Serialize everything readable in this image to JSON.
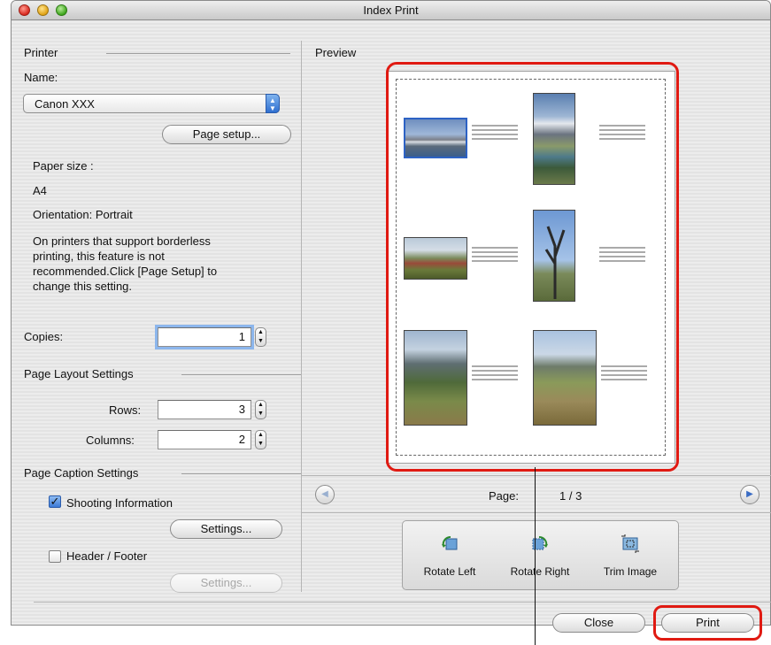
{
  "window": {
    "title": "Index Print"
  },
  "printer": {
    "section_label": "Printer",
    "name_label": "Name:",
    "name_value": "Canon XXX",
    "page_setup_label": "Page setup...",
    "paper_size_label": "Paper size :",
    "paper_size_value": "A4",
    "orientation_text": "Orientation:  Portrait",
    "borderless_note": [
      "On printers that support borderless",
      "printing, this feature is not",
      "recommended.Click [Page Setup] to",
      "change this setting."
    ]
  },
  "copies": {
    "label": "Copies:",
    "value": "1"
  },
  "layout": {
    "section_label": "Page Layout Settings",
    "rows_label": "Rows:",
    "rows_value": "3",
    "columns_label": "Columns:",
    "columns_value": "2"
  },
  "caption": {
    "section_label": "Page Caption Settings",
    "shooting_info_label": "Shooting Information",
    "shooting_info_checked": true,
    "settings_label": "Settings...",
    "header_footer_label": "Header / Footer",
    "header_footer_checked": false,
    "settings2_label": "Settings..."
  },
  "preview": {
    "label": "Preview",
    "page_label": "Page:",
    "page_value": "1 / 3"
  },
  "tools": {
    "rotate_left": "Rotate Left",
    "rotate_right": "Rotate Right",
    "trim_image": "Trim Image"
  },
  "buttons": {
    "close": "Close",
    "print": "Print"
  },
  "colors": {
    "highlight": "#e01a12",
    "selection": "#2d62c4",
    "accent": "#3c7ad6"
  }
}
